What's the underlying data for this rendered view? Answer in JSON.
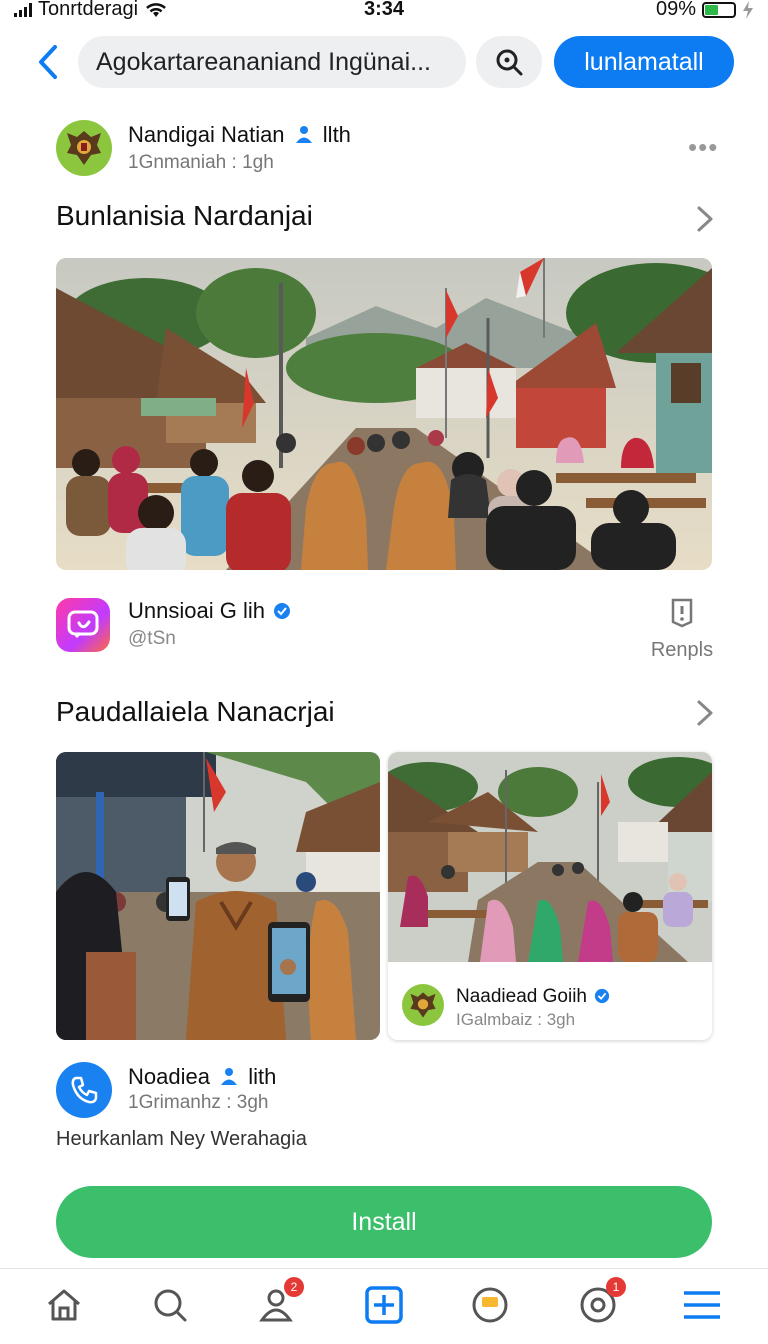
{
  "status_bar": {
    "carrier": "Tonrtderagi",
    "time": "3:34",
    "battery": "09%",
    "battery_level": 0.45
  },
  "header": {
    "search_text": "Agokartareananiand Ingünai...",
    "action_button": "lunlamatall",
    "icons": [
      "chevron-left-icon",
      "search-icon"
    ]
  },
  "post": {
    "author_name": "Nandigai Natian",
    "author_suffix": "llth",
    "author_sub": "1Gnmaniah : 1gh",
    "more": "•••"
  },
  "section1": {
    "title": "Bunlanisia Nardanjai"
  },
  "app_row": {
    "name": "Unnsioai G lih",
    "handle": "@tSn",
    "report_label": "Renpls"
  },
  "section2": {
    "title": "Paudallaiela Nanacrjai"
  },
  "card": {
    "name": "Naadiead Goiih",
    "sub": "IGalmbaiz : 3gh"
  },
  "contact": {
    "name": "Noadiea",
    "suffix": "lith",
    "sub": "1Grimanhz : 3gh",
    "description": "Heurkanlam Ney Werahagia"
  },
  "install_label": "Install",
  "tabbar": {
    "badges": {
      "people": "2",
      "record": "1"
    },
    "icons": [
      "home-icon",
      "search-icon",
      "people-icon",
      "add-icon",
      "wallet-icon",
      "record-icon",
      "menu-icon"
    ]
  },
  "colors": {
    "primary": "#0d7cf2",
    "install": "#3cbf6b",
    "badge": "#e53935",
    "verified": "#1a82f0"
  }
}
